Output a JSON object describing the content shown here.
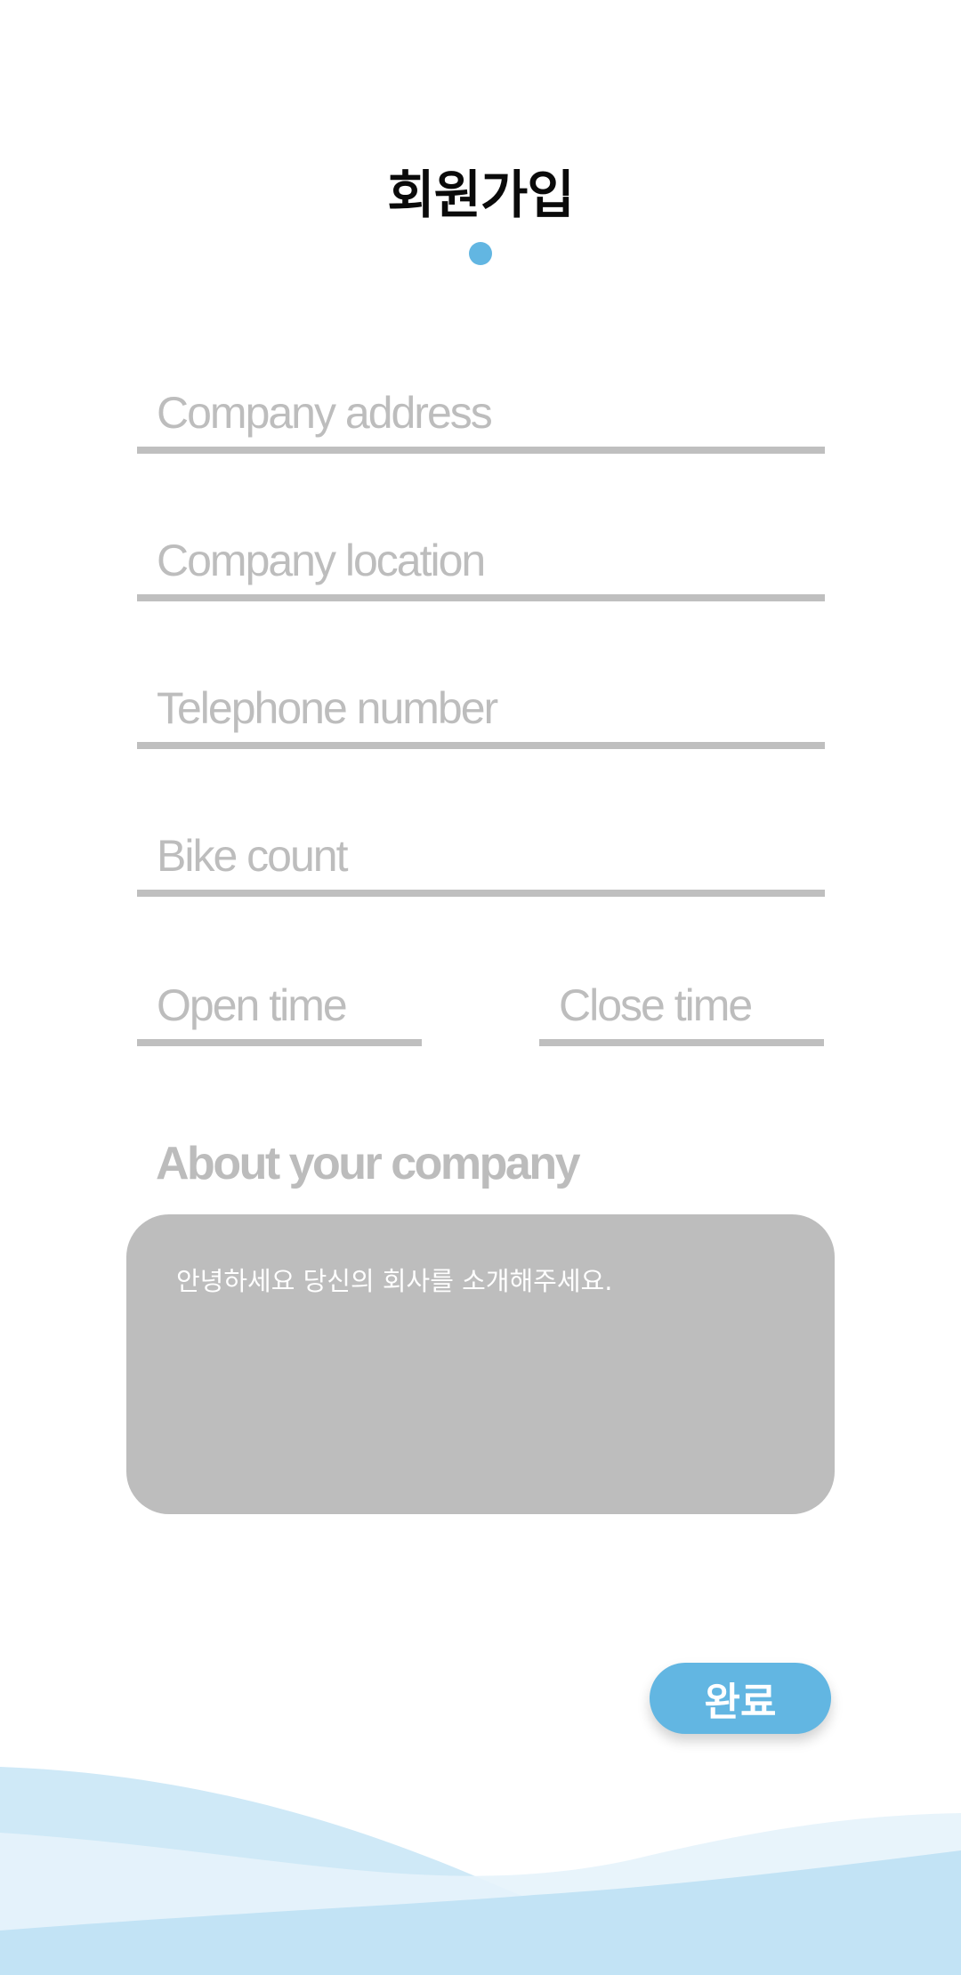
{
  "header": {
    "title": "회원가입"
  },
  "form": {
    "company_address": {
      "placeholder": "Company address",
      "value": ""
    },
    "company_location": {
      "placeholder": "Company location",
      "value": ""
    },
    "telephone": {
      "placeholder": "Telephone number",
      "value": ""
    },
    "bike_count": {
      "placeholder": "Bike count",
      "value": ""
    },
    "open_time": {
      "placeholder": "Open time",
      "value": ""
    },
    "close_time": {
      "placeholder": "Close time",
      "value": ""
    },
    "about": {
      "label": "About your company",
      "placeholder": "안녕하세요 당신의 회사를 소개해주세요."
    }
  },
  "actions": {
    "done_label": "완료"
  },
  "colors": {
    "accent": "#62b6e2",
    "underline": "#bfbfbf",
    "placeholder": "#bdbdbd",
    "textarea_bg": "#bdbdbd",
    "wave_light": "#e6f3fb",
    "wave_mid": "#b9e0f4"
  }
}
